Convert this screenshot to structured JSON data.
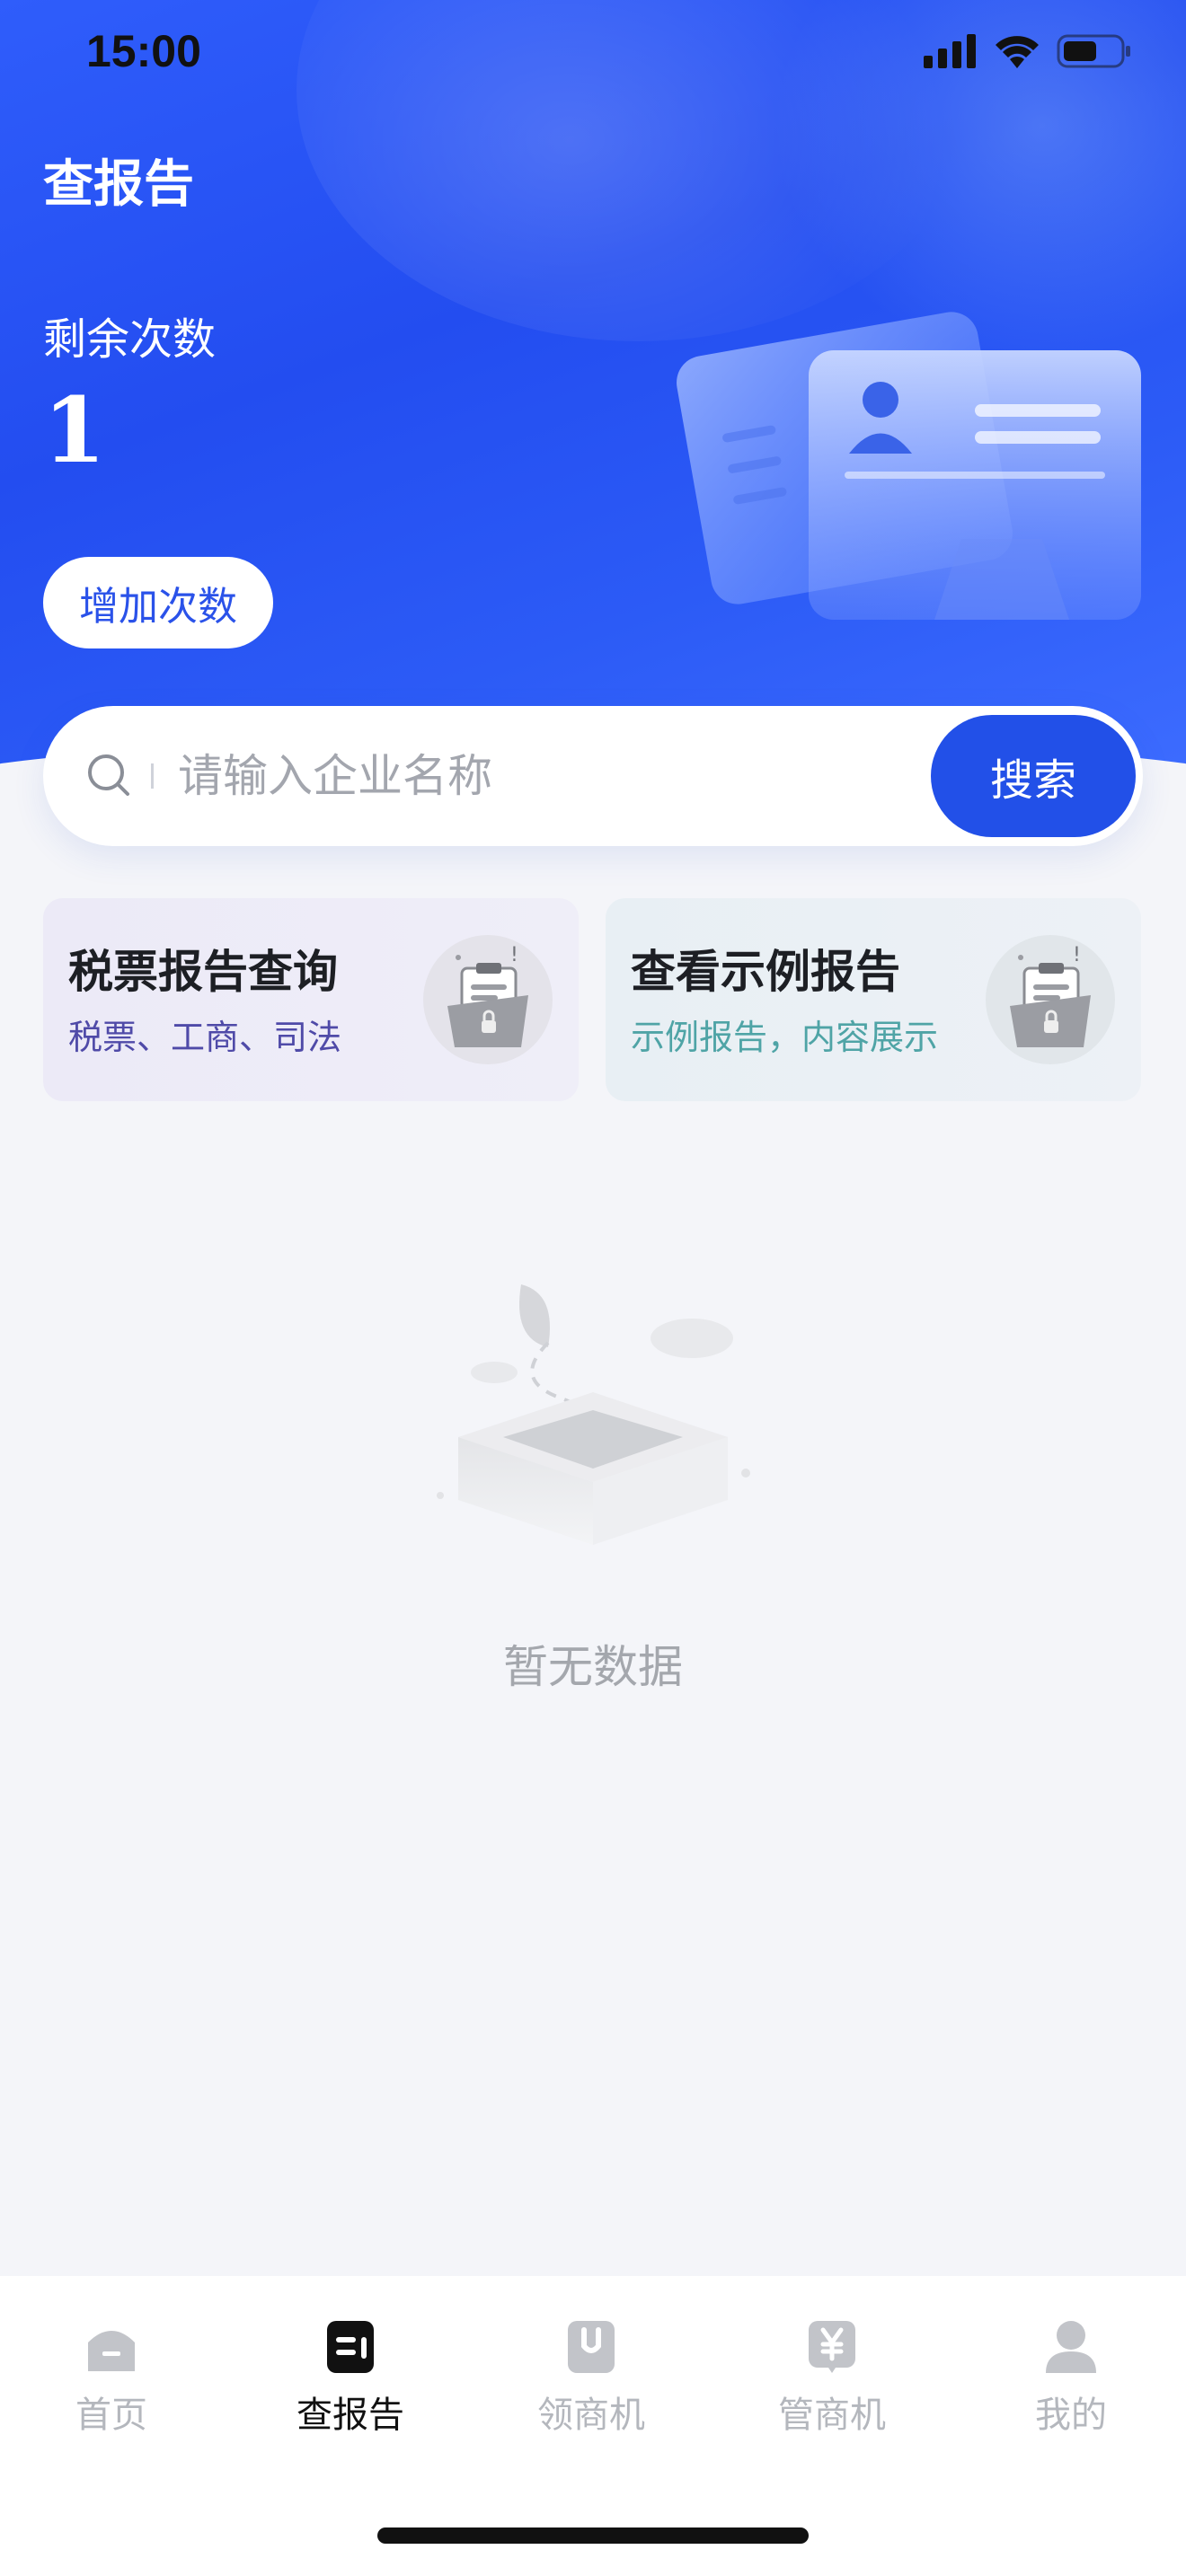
{
  "status_bar": {
    "time": "15:00"
  },
  "header": {
    "title": "查报告",
    "remaining_label": "剩余次数",
    "remaining_count": "1",
    "add_button": "增加次数"
  },
  "search": {
    "placeholder": "请输入企业名称",
    "button": "搜索"
  },
  "cards": [
    {
      "title": "税票报告查询",
      "subtitle": "税票、工商、司法"
    },
    {
      "title": "查看示例报告",
      "subtitle": "示例报告，内容展示"
    }
  ],
  "empty_state": {
    "text": "暂无数据"
  },
  "tabbar": {
    "items": [
      {
        "label": "首页",
        "icon": "home-icon",
        "active": false
      },
      {
        "label": "查报告",
        "icon": "report-icon",
        "active": true
      },
      {
        "label": "领商机",
        "icon": "bag-icon",
        "active": false
      },
      {
        "label": "管商机",
        "icon": "yen-icon",
        "active": false
      },
      {
        "label": "我的",
        "icon": "user-icon",
        "active": false
      }
    ]
  },
  "colors": {
    "primary": "#2250e8",
    "inactive_tab": "#b4b7bd"
  }
}
